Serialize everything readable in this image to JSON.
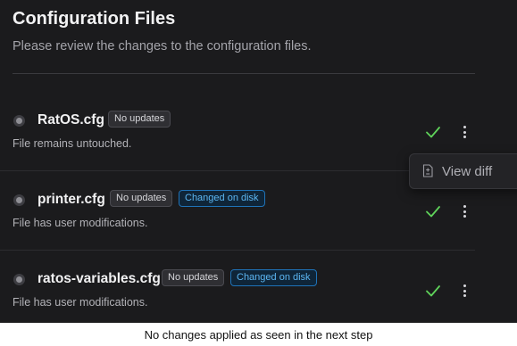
{
  "header": {
    "title": "Configuration Files",
    "subtitle": "Please review the changes to the configuration files."
  },
  "files": [
    {
      "name": "RatOS.cfg",
      "badges": [
        {
          "label": "No updates",
          "style": "gray"
        }
      ],
      "description": "File remains untouched.",
      "status": "check-icon",
      "action": "more-vertical-icon"
    },
    {
      "name": "printer.cfg",
      "badges": [
        {
          "label": "No updates",
          "style": "gray"
        },
        {
          "label": "Changed on disk",
          "style": "blue"
        }
      ],
      "description": "File has user modifications.",
      "status": "check-icon",
      "action": "more-vertical-icon"
    },
    {
      "name": "ratos-variables.cfg",
      "badges": [
        {
          "label": "No updates",
          "style": "gray"
        },
        {
          "label": "Changed on disk",
          "style": "blue"
        }
      ],
      "description": "File has user modifications.",
      "status": "check-icon",
      "action": "more-vertical-icon"
    }
  ],
  "context_menu": {
    "items": [
      {
        "label": "View diff",
        "icon": "file-diff-icon"
      }
    ]
  },
  "colors": {
    "background": "#1b1b1d",
    "check": "#5fd35a",
    "badge_blue": "#5cb6f2"
  },
  "caption": "No changes applied as seen in the next step"
}
